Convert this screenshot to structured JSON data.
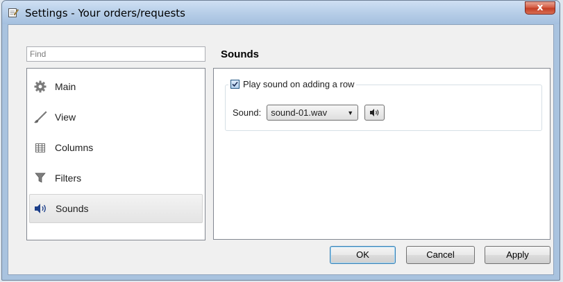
{
  "window": {
    "title": "Settings - Your orders/requests",
    "close_label": "x"
  },
  "search": {
    "placeholder": "Find"
  },
  "sidebar": {
    "items": [
      {
        "label": "Main",
        "icon": "gear-icon"
      },
      {
        "label": "View",
        "icon": "brush-icon"
      },
      {
        "label": "Columns",
        "icon": "table-columns-icon"
      },
      {
        "label": "Filters",
        "icon": "funnel-icon"
      },
      {
        "label": "Sounds",
        "icon": "speaker-icon",
        "selected": true
      }
    ]
  },
  "main": {
    "title": "Sounds",
    "play_on_add": {
      "label": "Play sound on adding a row",
      "checked": true
    },
    "sound": {
      "label": "Sound:",
      "value": "sound-01.wav"
    }
  },
  "buttons": {
    "ok": "OK",
    "cancel": "Cancel",
    "apply": "Apply"
  }
}
